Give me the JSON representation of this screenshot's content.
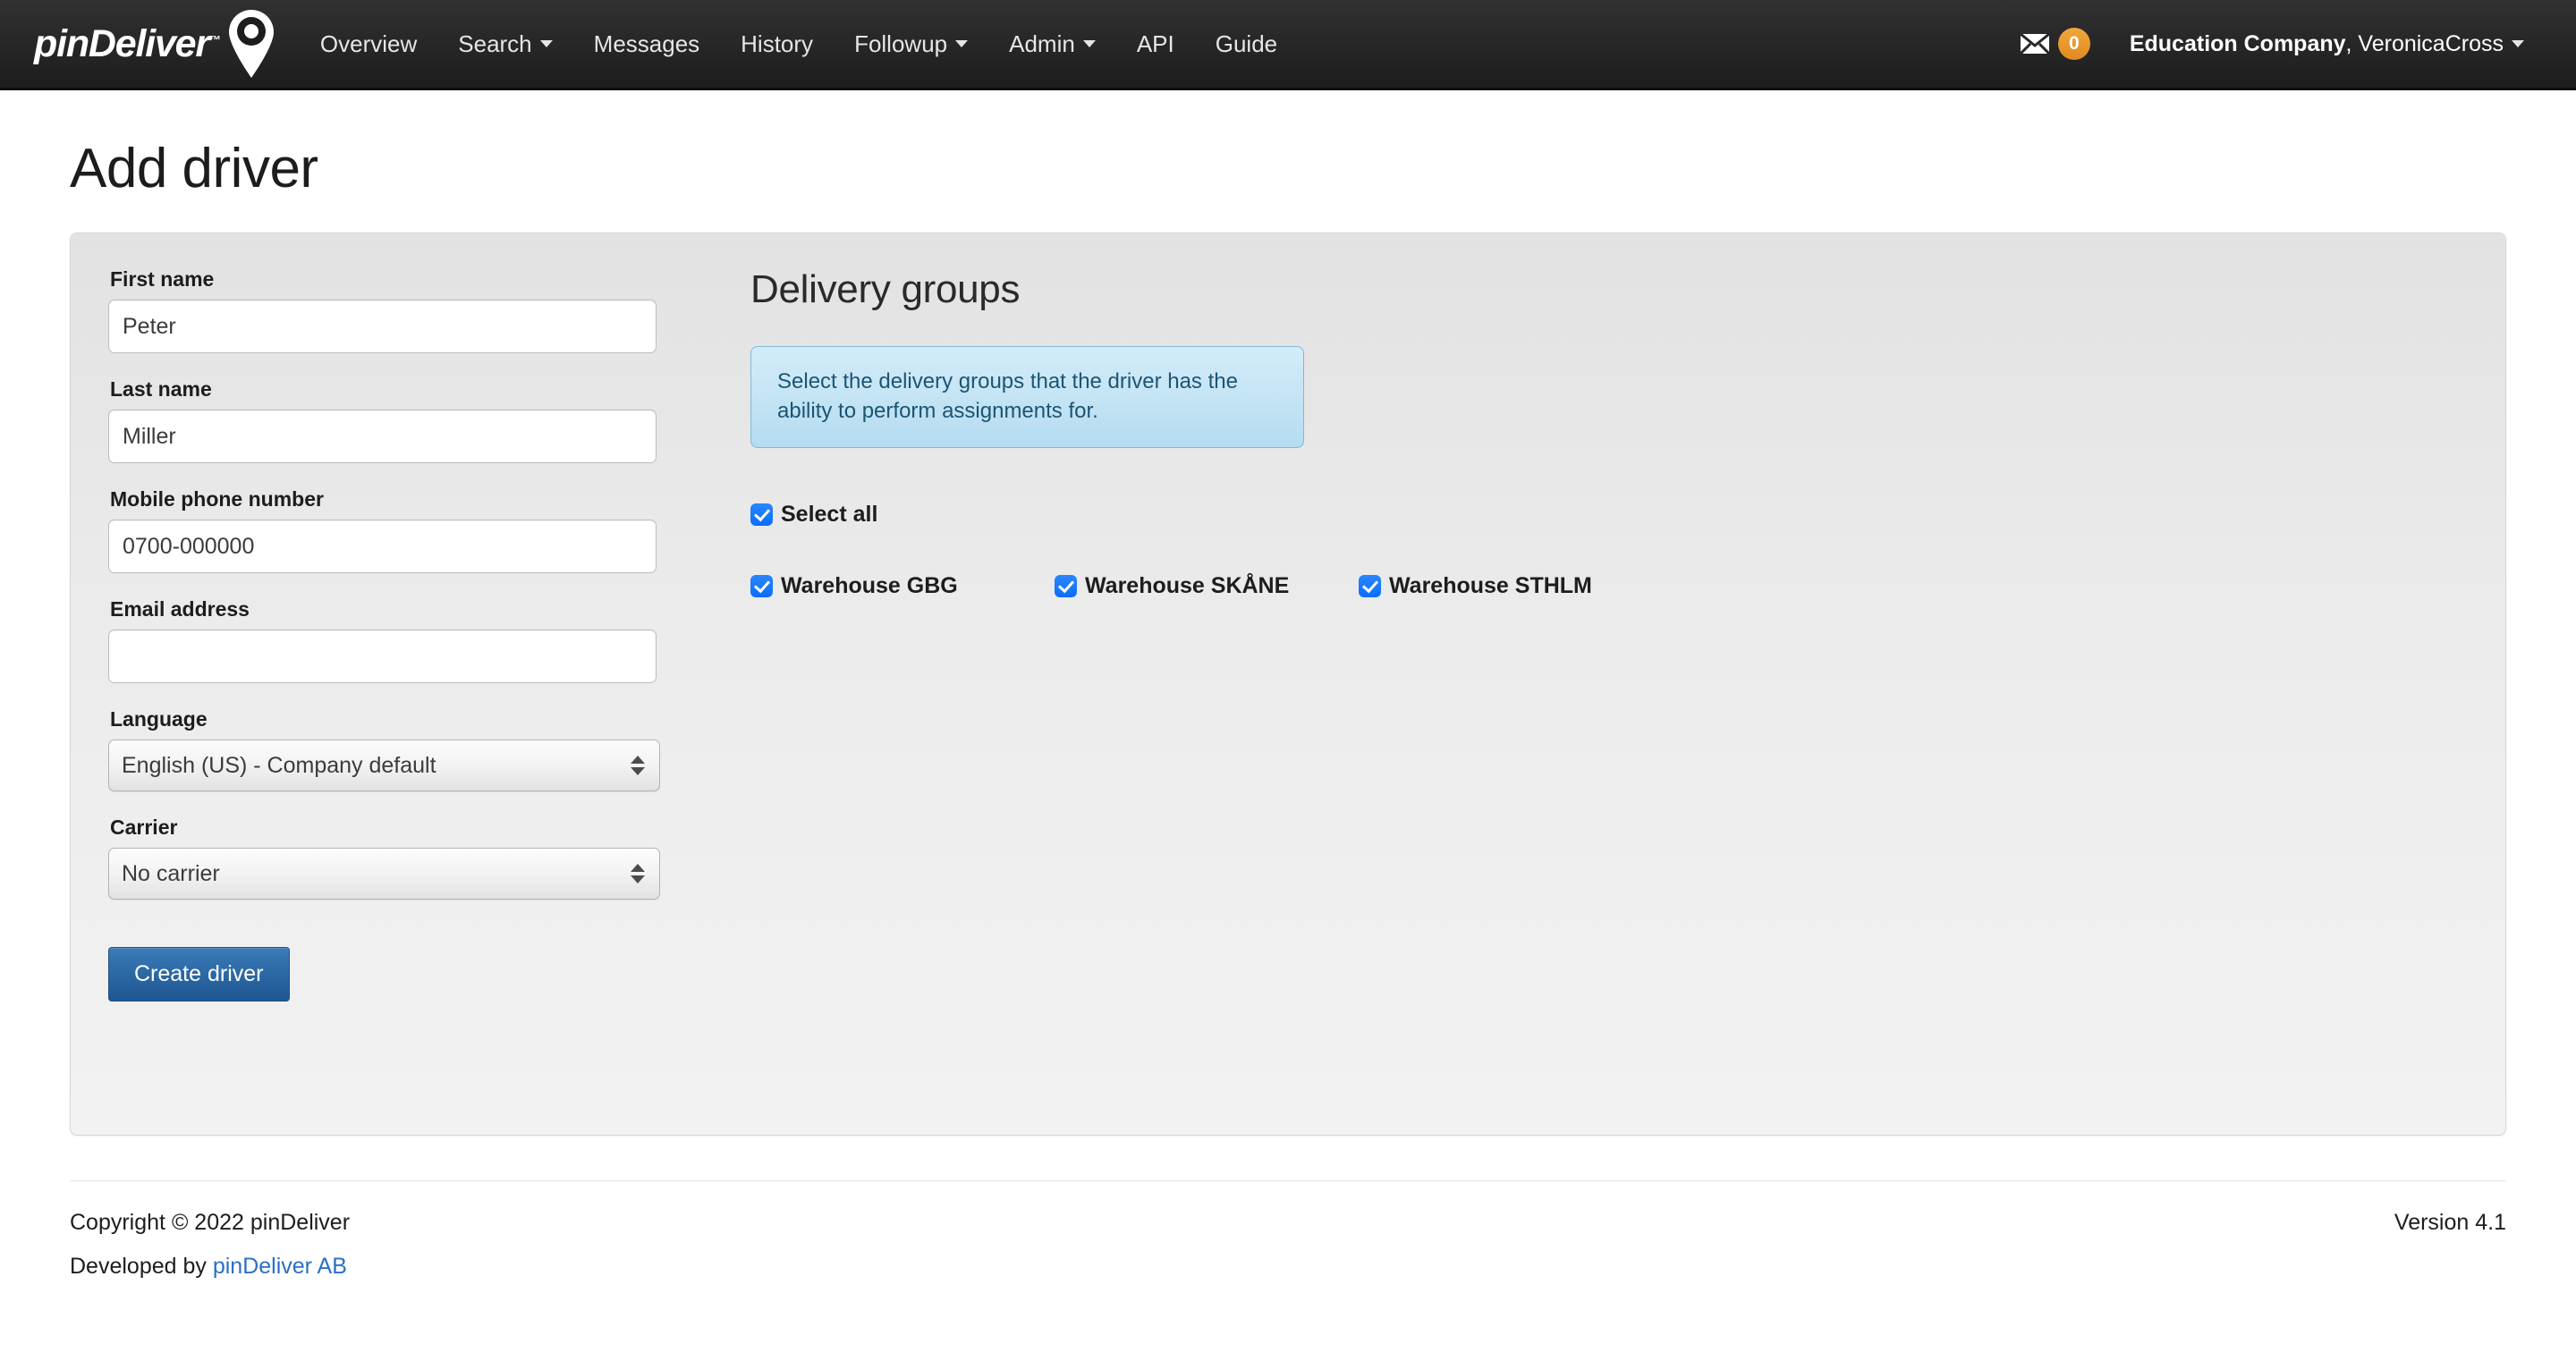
{
  "navbar": {
    "brand": {
      "name": "pinDeliver",
      "tm": "™",
      "icon": "map-pin-icon"
    },
    "links": [
      {
        "label": "Overview",
        "caret": false
      },
      {
        "label": "Search",
        "caret": true
      },
      {
        "label": "Messages",
        "caret": false
      },
      {
        "label": "History",
        "caret": false
      },
      {
        "label": "Followup",
        "caret": true
      },
      {
        "label": "Admin",
        "caret": true
      },
      {
        "label": "API",
        "caret": false
      },
      {
        "label": "Guide",
        "caret": false
      }
    ],
    "messages": {
      "icon": "envelope-icon",
      "count": "0"
    },
    "user": {
      "company": "Education Company",
      "name": ", VeronicaCross"
    }
  },
  "page": {
    "title": "Add driver"
  },
  "form": {
    "first_name": {
      "label": "First name",
      "value": "Peter",
      "placeholder": ""
    },
    "last_name": {
      "label": "Last name",
      "value": "Miller",
      "placeholder": ""
    },
    "mobile": {
      "label": "Mobile phone number",
      "value": "0700-000000",
      "placeholder": ""
    },
    "email": {
      "label": "Email address",
      "value": "",
      "placeholder": ""
    },
    "language": {
      "label": "Language",
      "selected": "English (US) - Company default",
      "options": [
        "English (US) - Company default"
      ]
    },
    "carrier": {
      "label": "Carrier",
      "selected": "No carrier",
      "options": [
        "No carrier"
      ]
    },
    "submit_label": "Create driver"
  },
  "delivery_groups": {
    "title": "Delivery groups",
    "info": "Select the delivery groups that the driver has the ability to perform assignments for.",
    "select_all": {
      "label": "Select all",
      "checked": true
    },
    "groups": [
      {
        "label": "Warehouse GBG",
        "checked": true
      },
      {
        "label": "Warehouse SKÅNE",
        "checked": true
      },
      {
        "label": "Warehouse STHLM",
        "checked": true
      }
    ]
  },
  "footer": {
    "copyright": "Copyright © 2022 pinDeliver",
    "developed_by_prefix": "Developed by ",
    "developed_by_link": "pinDeliver AB",
    "version": "Version 4.1"
  },
  "colors": {
    "navbar_bg": "#262626",
    "badge_orange": "#e08a1e",
    "primary_button": "#2d6aa6",
    "link_blue": "#2b70c2",
    "checkbox_blue": "#0a6efb",
    "info_box_bg": "#b5dcf0",
    "info_box_text": "#1c5573"
  }
}
